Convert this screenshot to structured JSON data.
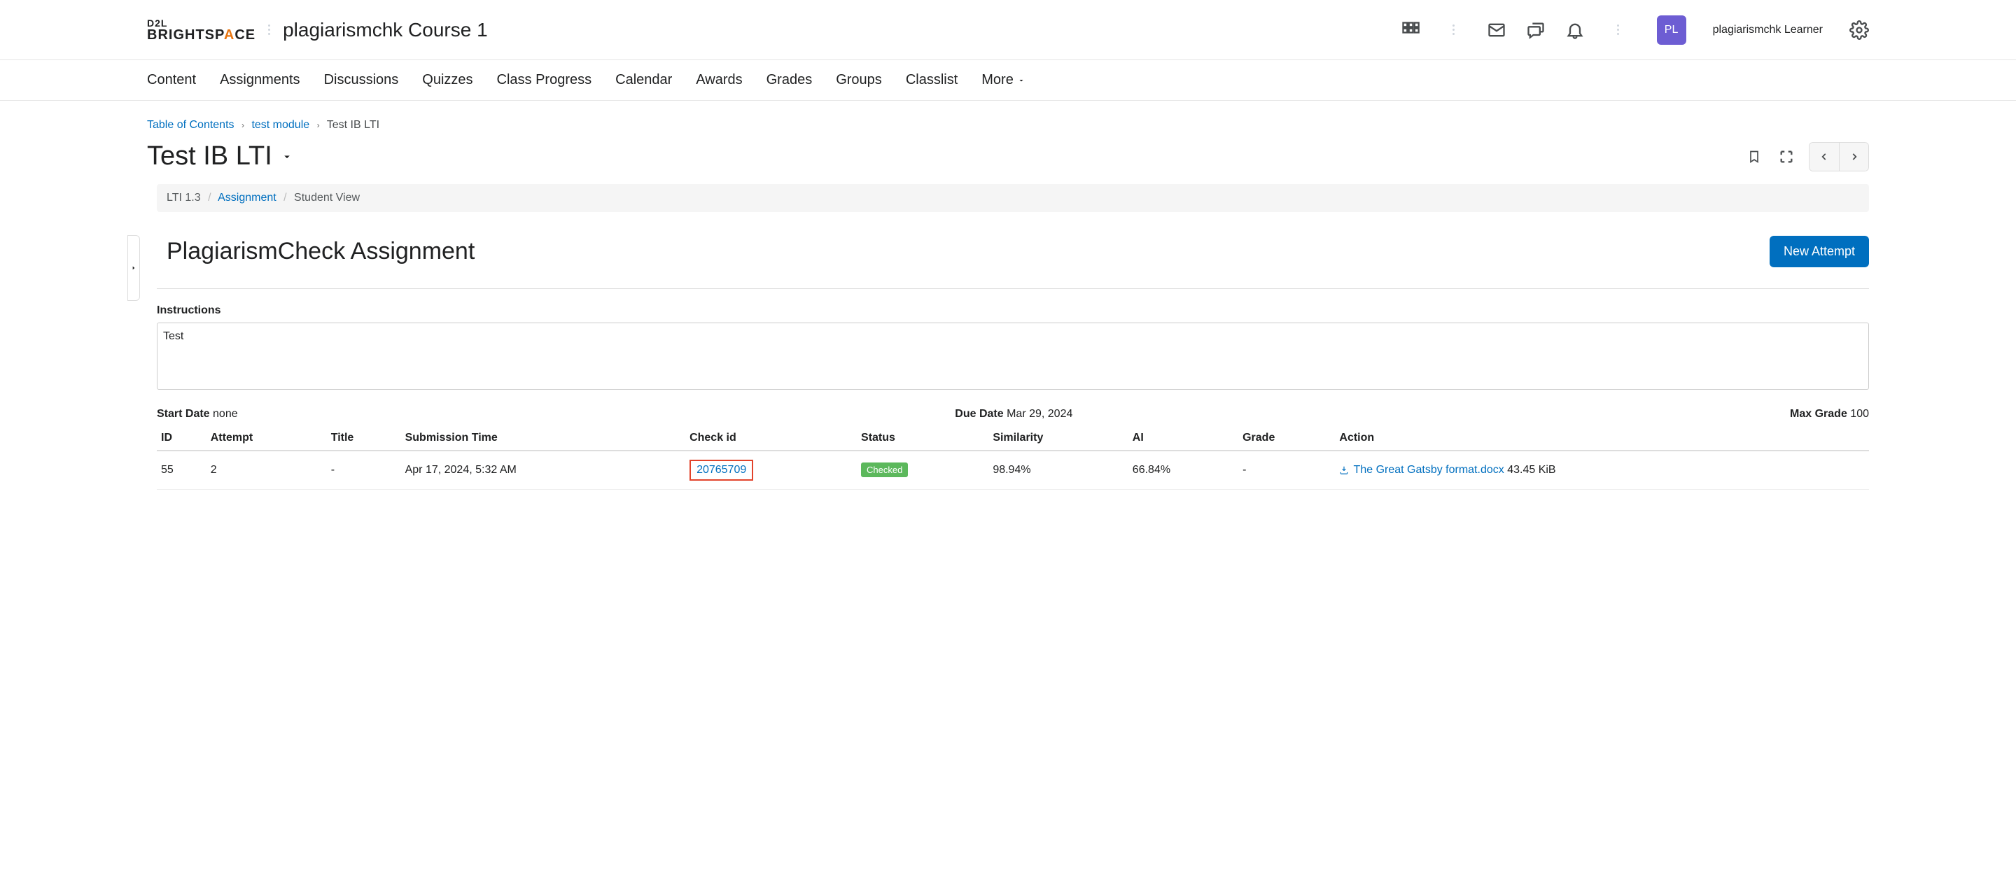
{
  "header": {
    "logo_top": "D2L",
    "logo_bottom_pre": "BRIGHTSP",
    "logo_bottom_accent": "A",
    "logo_bottom_post": "CE",
    "course_title": "plagiarismchk Course 1",
    "avatar_initials": "PL",
    "username": "plagiarismchk Learner"
  },
  "nav": {
    "items": [
      "Content",
      "Assignments",
      "Discussions",
      "Quizzes",
      "Class Progress",
      "Calendar",
      "Awards",
      "Grades",
      "Groups",
      "Classlist"
    ],
    "more_label": "More"
  },
  "breadcrumb_top": {
    "items": [
      {
        "label": "Table of Contents",
        "link": true
      },
      {
        "label": "test module",
        "link": true
      },
      {
        "label": "Test IB LTI",
        "link": false
      }
    ]
  },
  "page": {
    "title": "Test IB LTI"
  },
  "lti_breadcrumb": {
    "root": "LTI 1.3",
    "link": "Assignment",
    "current": "Student View"
  },
  "assignment": {
    "title": "PlagiarismCheck Assignment",
    "new_attempt_label": "New Attempt",
    "instructions_label": "Instructions",
    "instructions_text": "Test",
    "start_date_label": "Start Date",
    "start_date_value": "none",
    "due_date_label": "Due Date",
    "due_date_value": "Mar 29, 2024",
    "max_grade_label": "Max Grade",
    "max_grade_value": "100"
  },
  "table": {
    "headers": [
      "ID",
      "Attempt",
      "Title",
      "Submission Time",
      "Check id",
      "Status",
      "Similarity",
      "AI",
      "Grade",
      "Action"
    ],
    "row": {
      "id": "55",
      "attempt": "2",
      "title": "-",
      "submission_time": "Apr 17, 2024, 5:32 AM",
      "check_id": "20765709",
      "status": "Checked",
      "similarity": "98.94%",
      "ai": "66.84%",
      "grade": "-",
      "action_file": "The Great Gatsby format.docx",
      "action_size": "43.45 KiB"
    }
  }
}
